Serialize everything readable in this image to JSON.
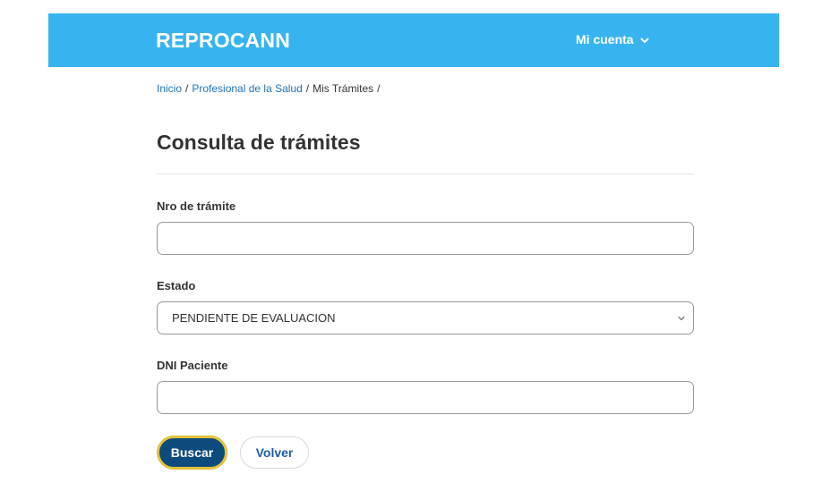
{
  "header": {
    "brand": "REPROCANN",
    "account_label": "Mi cuenta",
    "account_icon": "chevron-down-icon",
    "bar_color": "#37b4ef"
  },
  "breadcrumb": {
    "items": [
      {
        "label": "Inicio",
        "link": true
      },
      {
        "label": "Profesional de la Salud",
        "link": true
      },
      {
        "label": "Mis Trámites",
        "link": false
      }
    ],
    "separator": "/"
  },
  "main": {
    "title": "Consulta de trámites",
    "fields": {
      "nro_tramite": {
        "label": "Nro de trámite",
        "value": "",
        "placeholder": ""
      },
      "estado": {
        "label": "Estado",
        "selected": "PENDIENTE DE EVALUACION"
      },
      "dni_paciente": {
        "label": "DNI Paciente",
        "value": "",
        "placeholder": ""
      }
    },
    "buttons": {
      "search_label": "Buscar",
      "back_label": "Volver"
    }
  },
  "colors": {
    "primary_button": "#0e4b7d",
    "focus_ring": "#e8c53a",
    "link": "#1f72b5"
  }
}
